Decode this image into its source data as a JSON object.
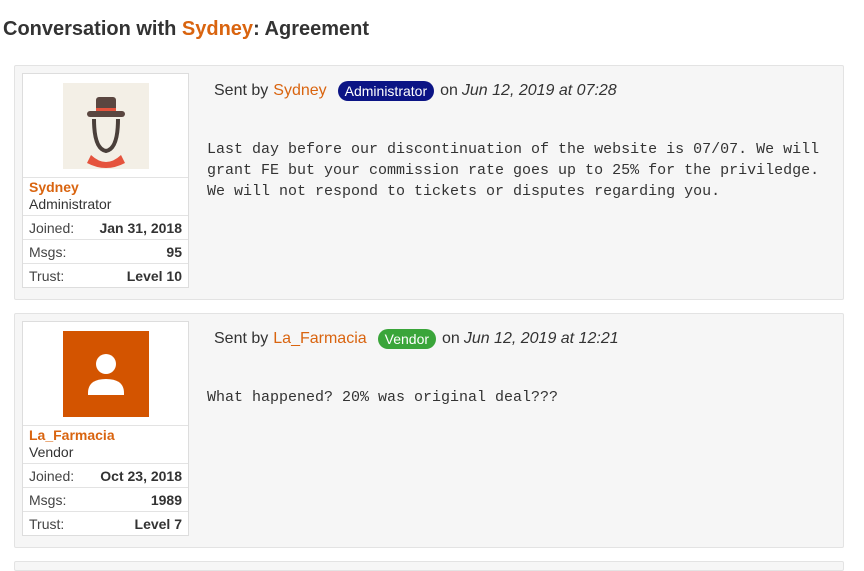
{
  "page": {
    "title_prefix": "Conversation with ",
    "title_name": "Sydney",
    "title_suffix": ": Agreement"
  },
  "messages": [
    {
      "user": {
        "name": "Sydney",
        "role": "Administrator",
        "avatar": "hat-woman-avatar",
        "stats": [
          {
            "label": "Joined:",
            "value": "Jan 31, 2018"
          },
          {
            "label": "Msgs:",
            "value": "95"
          },
          {
            "label": "Trust:",
            "value": "Level 10"
          }
        ]
      },
      "sent_by": "Sent by",
      "sender": "Sydney",
      "badge": "Administrator",
      "on": "on",
      "date": "Jun 12, 2019 at 07:28",
      "body": "Last day before our discontinuation of the website is 07/07. We will grant FE but your commission rate goes up to 25% for the priviledge. We will not respond to tickets or disputes regarding you."
    },
    {
      "user": {
        "name": "La_Farmacia",
        "role": "Vendor",
        "avatar": "default-person-avatar",
        "stats": [
          {
            "label": "Joined:",
            "value": "Oct 23, 2018"
          },
          {
            "label": "Msgs:",
            "value": "1989"
          },
          {
            "label": "Trust:",
            "value": "Level 7"
          }
        ]
      },
      "sent_by": "Sent by",
      "sender": "La_Farmacia",
      "badge": "Vendor",
      "on": "on",
      "date": "Jun 12, 2019 at 12:21",
      "body": "What happened? 20% was original deal???"
    }
  ],
  "colors": {
    "accent": "#d9640f",
    "admin_badge": "#0b1485",
    "vendor_badge": "#3aa53a"
  }
}
